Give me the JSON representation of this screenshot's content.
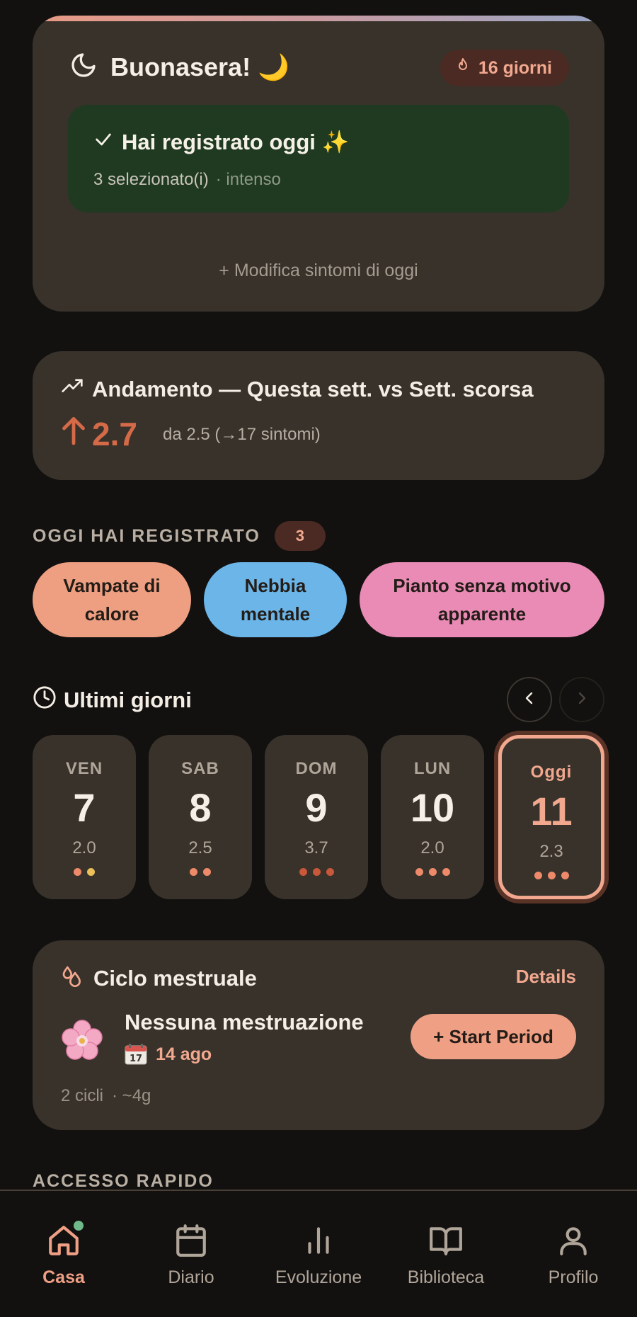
{
  "greeting": {
    "title": "Buonasera! 🌙",
    "streak": "16 giorni",
    "logged_title": "Hai registrato oggi ✨",
    "logged_count": "3 selezionato(i)",
    "logged_intensity": "· intenso",
    "edit_link": "+ Modifica sintomi di oggi"
  },
  "trend": {
    "title": "Andamento — Questa sett. vs Sett. scorsa",
    "value": "2.7",
    "from_text": "da 2.5 (→17 sintomi)"
  },
  "today_logged": {
    "label": "OGGI HAI REGISTRATO",
    "count": "3",
    "chips": [
      {
        "label": "Vampate di calore",
        "color": "#ee9f82"
      },
      {
        "label": "Nebbia mentale",
        "color": "#6bb5e8"
      },
      {
        "label": "Pianto senza motivo apparente",
        "color": "#e98bb5"
      }
    ]
  },
  "recent_days": {
    "title": "Ultimi giorni",
    "days": [
      {
        "name": "VEN",
        "num": "7",
        "score": "2.0",
        "dots": [
          "#ee8a6a",
          "#e9c05a"
        ]
      },
      {
        "name": "SAB",
        "num": "8",
        "score": "2.5",
        "dots": [
          "#ee8a6a",
          "#ee8a6a"
        ]
      },
      {
        "name": "DOM",
        "num": "9",
        "score": "3.7",
        "dots": [
          "#c9573a",
          "#c9573a",
          "#c9573a"
        ]
      },
      {
        "name": "LUN",
        "num": "10",
        "score": "2.0",
        "dots": [
          "#ee8a6a",
          "#ee8a6a",
          "#ee8a6a"
        ]
      },
      {
        "name": "Oggi",
        "num": "11",
        "score": "2.3",
        "dots": [
          "#ee8a6a",
          "#ee8a6a",
          "#ee8a6a"
        ]
      }
    ]
  },
  "cycle": {
    "title": "Ciclo mestruale",
    "details": "Details",
    "status": "Nessuna mestruazione",
    "date": "14 ago",
    "start_button": "+ Start Period",
    "cycles": "2 cicli",
    "avg": "· ~4g"
  },
  "quick_access": {
    "label": "ACCESSO RAPIDO"
  },
  "nav": {
    "items": [
      {
        "label": "Casa",
        "icon": "home-icon"
      },
      {
        "label": "Diario",
        "icon": "calendar-icon"
      },
      {
        "label": "Evoluzione",
        "icon": "bar-chart-icon"
      },
      {
        "label": "Biblioteca",
        "icon": "book-icon"
      },
      {
        "label": "Profilo",
        "icon": "user-icon"
      }
    ]
  },
  "colors": {
    "accent": "#f2a88f",
    "background": "#121110",
    "card": "#38322b",
    "success_box": "#1f3a20",
    "trend_up": "#d46a47"
  }
}
